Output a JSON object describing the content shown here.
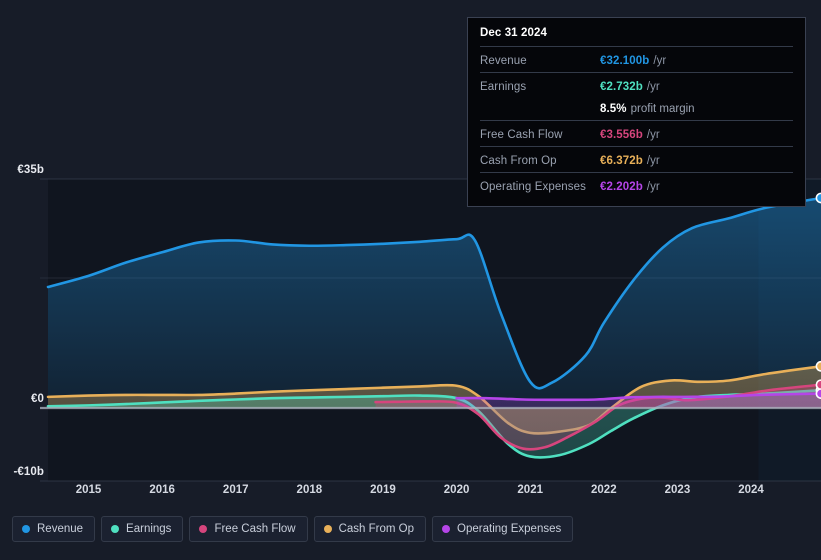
{
  "theme": {
    "background": "#171c28",
    "plot_background": "#10151f",
    "gridline": "#333a49",
    "zero_line": "#aeb4c0",
    "tooltip_bg": "#05060a",
    "tooltip_border": "#3a4152"
  },
  "series_colors": {
    "revenue": "#2196e3",
    "earnings": "#4fe0c0",
    "free_cash_flow": "#d6457d",
    "cash_from_op": "#e8b059",
    "operating_expenses": "#b545e8"
  },
  "tooltip": {
    "date": "Dec 31 2024",
    "rows": [
      {
        "name": "Revenue",
        "value": "€32.100b",
        "unit": "/yr",
        "color": "#2196e3"
      },
      {
        "name": "Earnings",
        "value": "€2.732b",
        "unit": "/yr",
        "color": "#4fe0c0"
      },
      {
        "name": "",
        "value": "8.5%",
        "unit": "",
        "suffix": "profit margin",
        "color": "#ffffff"
      },
      {
        "name": "Free Cash Flow",
        "value": "€3.556b",
        "unit": "/yr",
        "color": "#d6457d"
      },
      {
        "name": "Cash From Op",
        "value": "€6.372b",
        "unit": "/yr",
        "color": "#e8b059"
      },
      {
        "name": "Operating Expenses",
        "value": "€2.202b",
        "unit": "/yr",
        "color": "#b545e8"
      }
    ]
  },
  "legend": {
    "items": [
      {
        "label": "Revenue",
        "color": "#2196e3"
      },
      {
        "label": "Earnings",
        "color": "#4fe0c0"
      },
      {
        "label": "Free Cash Flow",
        "color": "#d6457d"
      },
      {
        "label": "Cash From Op",
        "color": "#e8b059"
      },
      {
        "label": "Operating Expenses",
        "color": "#b545e8"
      }
    ]
  },
  "chart_data": {
    "type": "area",
    "title": "",
    "xlabel": "",
    "ylabel": "",
    "currency": "EUR",
    "units": "billions",
    "grid": true,
    "legend_position": "bottom",
    "ylim": [
      -10,
      35
    ],
    "y_ticks": [
      35,
      0,
      -10
    ],
    "y_tick_labels": [
      "€35b",
      "€0",
      "-€10b"
    ],
    "x_ticks": [
      2015,
      2016,
      2017,
      2018,
      2019,
      2020,
      2021,
      2022,
      2023,
      2024
    ],
    "x_tick_labels": [
      "2015",
      "2016",
      "2017",
      "2018",
      "2019",
      "2020",
      "2021",
      "2022",
      "2023",
      "2024"
    ],
    "xlim": [
      2014.45,
      2024.95
    ],
    "forecast_band_start": 2024.1,
    "series": [
      {
        "name": "Revenue",
        "color": "#2196e3",
        "x": [
          2014.45,
          2015.0,
          2015.5,
          2016.0,
          2016.5,
          2017.0,
          2017.5,
          2018.0,
          2018.5,
          2019.0,
          2019.5,
          2020.0,
          2020.25,
          2020.6,
          2021.0,
          2021.3,
          2021.75,
          2022.0,
          2022.4,
          2022.8,
          2023.2,
          2023.7,
          2024.2,
          2024.95
        ],
        "values": [
          18.5,
          20.2,
          22.2,
          23.8,
          25.3,
          25.6,
          25.0,
          24.8,
          24.9,
          25.1,
          25.4,
          25.8,
          25.6,
          14.5,
          4.0,
          3.9,
          8.0,
          13.0,
          19.5,
          24.5,
          27.5,
          29.0,
          30.6,
          32.1
        ]
      },
      {
        "name": "Earnings",
        "color": "#4fe0c0",
        "x": [
          2014.45,
          2015.0,
          2015.5,
          2016.0,
          2016.5,
          2017.0,
          2017.5,
          2018.0,
          2018.5,
          2019.0,
          2019.5,
          2020.0,
          2020.3,
          2020.7,
          2021.0,
          2021.4,
          2021.8,
          2022.1,
          2022.4,
          2022.8,
          2023.2,
          2023.7,
          2024.2,
          2024.95
        ],
        "values": [
          0.25,
          0.4,
          0.6,
          0.85,
          1.1,
          1.3,
          1.5,
          1.6,
          1.7,
          1.8,
          1.9,
          1.5,
          -0.5,
          -5.5,
          -7.4,
          -7.2,
          -5.5,
          -3.5,
          -1.6,
          0.4,
          1.6,
          2.0,
          2.2,
          2.73
        ]
      },
      {
        "name": "Free Cash Flow",
        "color": "#d6457d",
        "x": [
          2018.9,
          2019.2,
          2019.6,
          2020.0,
          2020.3,
          2020.6,
          2020.9,
          2021.2,
          2021.5,
          2021.9,
          2022.2,
          2022.5,
          2022.8,
          2023.1,
          2023.5,
          2023.9,
          2024.3,
          2024.95
        ],
        "values": [
          0.9,
          0.95,
          1.0,
          0.8,
          -1.0,
          -4.5,
          -6.2,
          -6.0,
          -4.5,
          -2.0,
          0.4,
          1.4,
          1.6,
          1.2,
          1.5,
          2.1,
          2.8,
          3.556
        ]
      },
      {
        "name": "Cash From Op",
        "color": "#e8b059",
        "x": [
          2014.45,
          2015.0,
          2015.5,
          2016.0,
          2016.5,
          2017.0,
          2017.5,
          2018.0,
          2018.5,
          2019.0,
          2019.5,
          2020.0,
          2020.3,
          2020.7,
          2021.0,
          2021.4,
          2021.8,
          2022.1,
          2022.5,
          2022.9,
          2023.3,
          2023.7,
          2024.2,
          2024.95
        ],
        "values": [
          1.7,
          1.9,
          2.0,
          2.0,
          2.0,
          2.2,
          2.5,
          2.7,
          2.9,
          3.1,
          3.3,
          3.4,
          1.8,
          -2.3,
          -3.8,
          -3.6,
          -2.6,
          0.0,
          3.2,
          4.2,
          4.0,
          4.2,
          5.2,
          6.372
        ]
      },
      {
        "name": "Operating Expenses",
        "color": "#b545e8",
        "x": [
          2020.0,
          2020.4,
          2020.9,
          2021.4,
          2021.9,
          2022.3,
          2022.7,
          2023.1,
          2023.6,
          2024.1,
          2024.95
        ],
        "values": [
          1.5,
          1.5,
          1.3,
          1.25,
          1.3,
          1.6,
          1.7,
          1.7,
          1.75,
          2.0,
          2.202
        ]
      }
    ]
  }
}
